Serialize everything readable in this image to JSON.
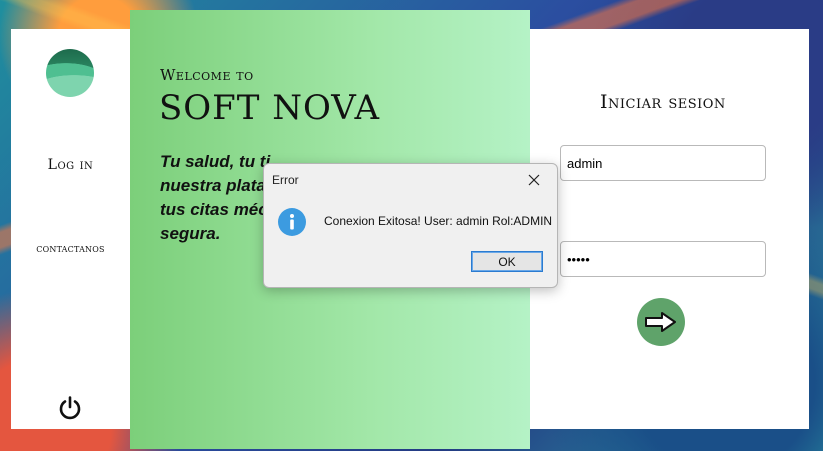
{
  "sidebar": {
    "logo_icon": "soft-nova-logo",
    "items": [
      {
        "label": "Log in"
      },
      {
        "label": "contactanos"
      }
    ],
    "power_icon": "power-icon"
  },
  "hero": {
    "welcome": "Welcome to",
    "title": "SOFT NOVA",
    "tagline": "Tu salud, tu ti...nuestra plata...tus citas méd...segura.",
    "tagline_lines": [
      "Tu salud, tu ti",
      "nuestra plata",
      "tus citas méc",
      "segura."
    ]
  },
  "login": {
    "title": "Iniciar sesion",
    "username_value": "admin",
    "password_value": "•••••",
    "submit_icon": "arrow-right-icon"
  },
  "dialog": {
    "title": "Error",
    "message": "Conexion Exitosa! User: admin Rol:ADMIN",
    "ok_label": "OK",
    "icon": "info-icon"
  },
  "colors": {
    "hero_start": "#7ccf7a",
    "hero_end": "#b5f2c6",
    "submit": "#5fa36a",
    "info": "#3c9be0"
  }
}
